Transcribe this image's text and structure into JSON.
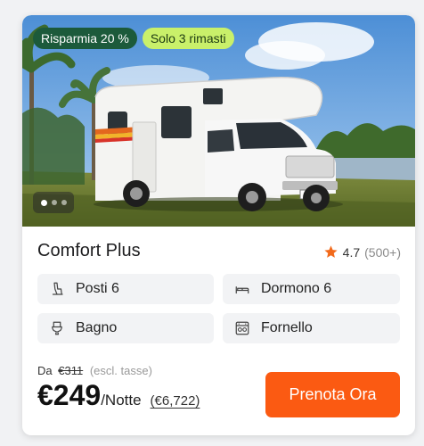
{
  "badges": {
    "discount": "Risparmia 20 %",
    "stock": "Solo 3 rimasti"
  },
  "gallery": {
    "total_images": 3,
    "active_index": 1
  },
  "listing": {
    "title": "Comfort Plus",
    "rating": "4.7",
    "reviews": "(500+)"
  },
  "features": [
    {
      "label": "Posti 6",
      "icon": "seat-icon"
    },
    {
      "label": "Dormono 6",
      "icon": "bed-icon"
    },
    {
      "label": "Bagno",
      "icon": "toilet-icon"
    },
    {
      "label": "Fornello",
      "icon": "stove-icon"
    }
  ],
  "price": {
    "from_label": "Da",
    "old_price": "€311",
    "tax_note": "(escl. tasse)",
    "current": "€249",
    "unit": "/Notte",
    "total": "(€6,722)"
  },
  "cta": {
    "label": "Prenota Ora"
  },
  "colors": {
    "accent": "#fb5a12",
    "discount_badge": "#1c5a3b",
    "stock_badge": "#c9f06a",
    "star": "#f26a1b"
  }
}
